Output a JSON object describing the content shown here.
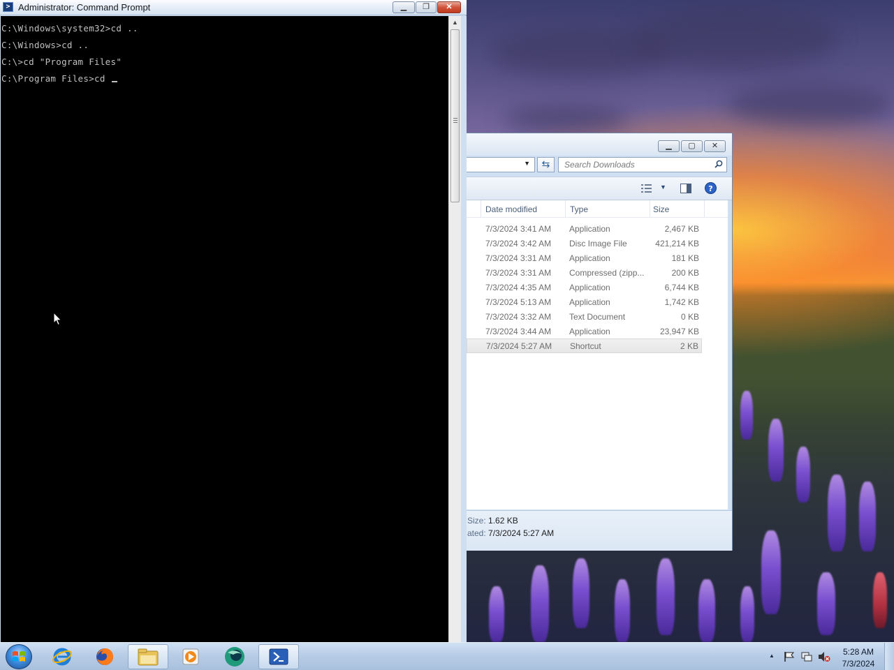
{
  "cmd": {
    "title": "Administrator: Command Prompt",
    "lines": [
      "C:\\Windows\\system32>cd ..",
      "C:\\Windows>cd ..",
      "C:\\>cd \"Program Files\"",
      "C:\\Program Files>cd "
    ]
  },
  "explorer": {
    "search_placeholder": "Search Downloads",
    "columns": {
      "date": "Date modified",
      "type": "Type",
      "size": "Size"
    },
    "rows": [
      {
        "date": "7/3/2024 3:41 AM",
        "type": "Application",
        "size": "2,467 KB"
      },
      {
        "date": "7/3/2024 3:42 AM",
        "type": "Disc Image File",
        "size": "421,214 KB"
      },
      {
        "date": "7/3/2024 3:31 AM",
        "type": "Application",
        "size": "181 KB"
      },
      {
        "date": "7/3/2024 3:31 AM",
        "type": "Compressed (zipp...",
        "size": "200 KB"
      },
      {
        "date": "7/3/2024 4:35 AM",
        "type": "Application",
        "size": "6,744 KB"
      },
      {
        "date": "7/3/2024 5:13 AM",
        "type": "Application",
        "size": "1,742 KB"
      },
      {
        "date": "7/3/2024 3:32 AM",
        "type": "Text Document",
        "size": "0 KB"
      },
      {
        "date": "7/3/2024 3:44 AM",
        "type": "Application",
        "size": "23,947 KB"
      },
      {
        "date": "7/3/2024 5:27 AM",
        "type": "Shortcut",
        "size": "2 KB"
      }
    ],
    "details": {
      "size_label": "Size:",
      "size_value": "1.62 KB",
      "created_label": "ated:",
      "created_value": "7/3/2024 5:27 AM"
    }
  },
  "taskbar": {
    "clock_time": "5:28 AM",
    "clock_date": "7/3/2024",
    "apps": [
      "windows-explorer",
      "internet-explorer",
      "firefox",
      "file-explorer",
      "media-player",
      "browser-globe",
      "command-prompt"
    ]
  }
}
